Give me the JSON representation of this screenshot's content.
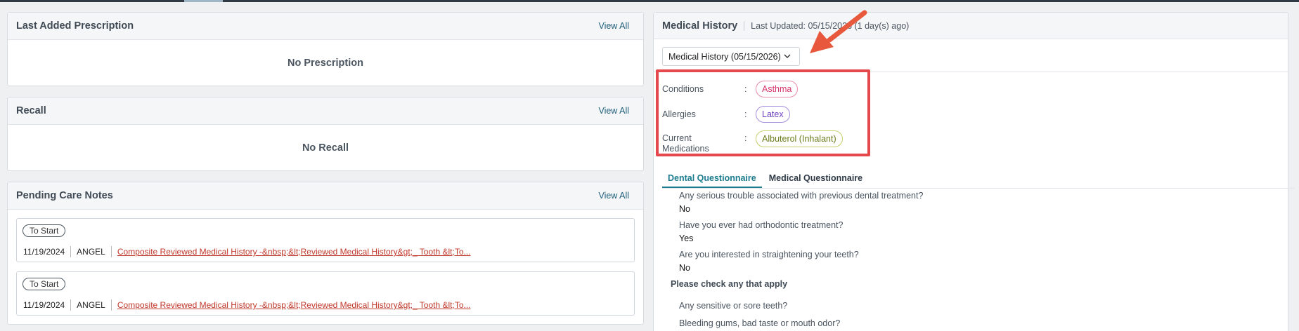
{
  "prescription": {
    "title": "Last Added Prescription",
    "view_all": "View All",
    "empty_text": "No Prescription"
  },
  "recall": {
    "title": "Recall",
    "view_all": "View All",
    "empty_text": "No Recall"
  },
  "care_notes": {
    "title": "Pending Care Notes",
    "view_all": "View All",
    "items": [
      {
        "status": "To Start",
        "date": "11/19/2024",
        "provider": "ANGEL",
        "link": "Composite Reviewed Medical History -&nbsp;&lt;Reviewed Medical History&gt;_ Tooth &lt;To..."
      },
      {
        "status": "To Start",
        "date": "11/19/2024",
        "provider": "ANGEL",
        "link": "Composite Reviewed Medical History -&nbsp;&lt;Reviewed Medical History&gt;_ Tooth &lt;To..."
      }
    ]
  },
  "medical_history": {
    "title": "Medical History",
    "last_updated": "Last Updated: 05/15/2026 (1 day(s) ago)",
    "selected_version": "Medical History (05/15/2026)",
    "rows": {
      "conditions": {
        "label": "Conditions",
        "colon": ":",
        "value": "Asthma"
      },
      "allergies": {
        "label": "Allergies",
        "colon": ":",
        "value": "Latex"
      },
      "medications": {
        "label": "Current Medications",
        "colon": ":",
        "value": "Albuterol (Inhalant)"
      }
    },
    "tabs": {
      "dental": "Dental Questionnaire",
      "medical": "Medical Questionnaire"
    },
    "questions": [
      {
        "q": "Any serious trouble associated with previous dental treatment?",
        "a": "No"
      },
      {
        "q": "Have you ever had orthodontic treatment?",
        "a": "Yes"
      },
      {
        "q": "Are you interested in straightening your teeth?",
        "a": "No"
      }
    ],
    "section_title": "Please check any that apply",
    "checks": [
      "Any sensitive or sore teeth?",
      "Bleeding gums, bad taste or mouth odor?"
    ]
  },
  "colors": {
    "highlight": "#e5484d",
    "arrow": "#e8583c",
    "accent": "#1c7c8f"
  }
}
